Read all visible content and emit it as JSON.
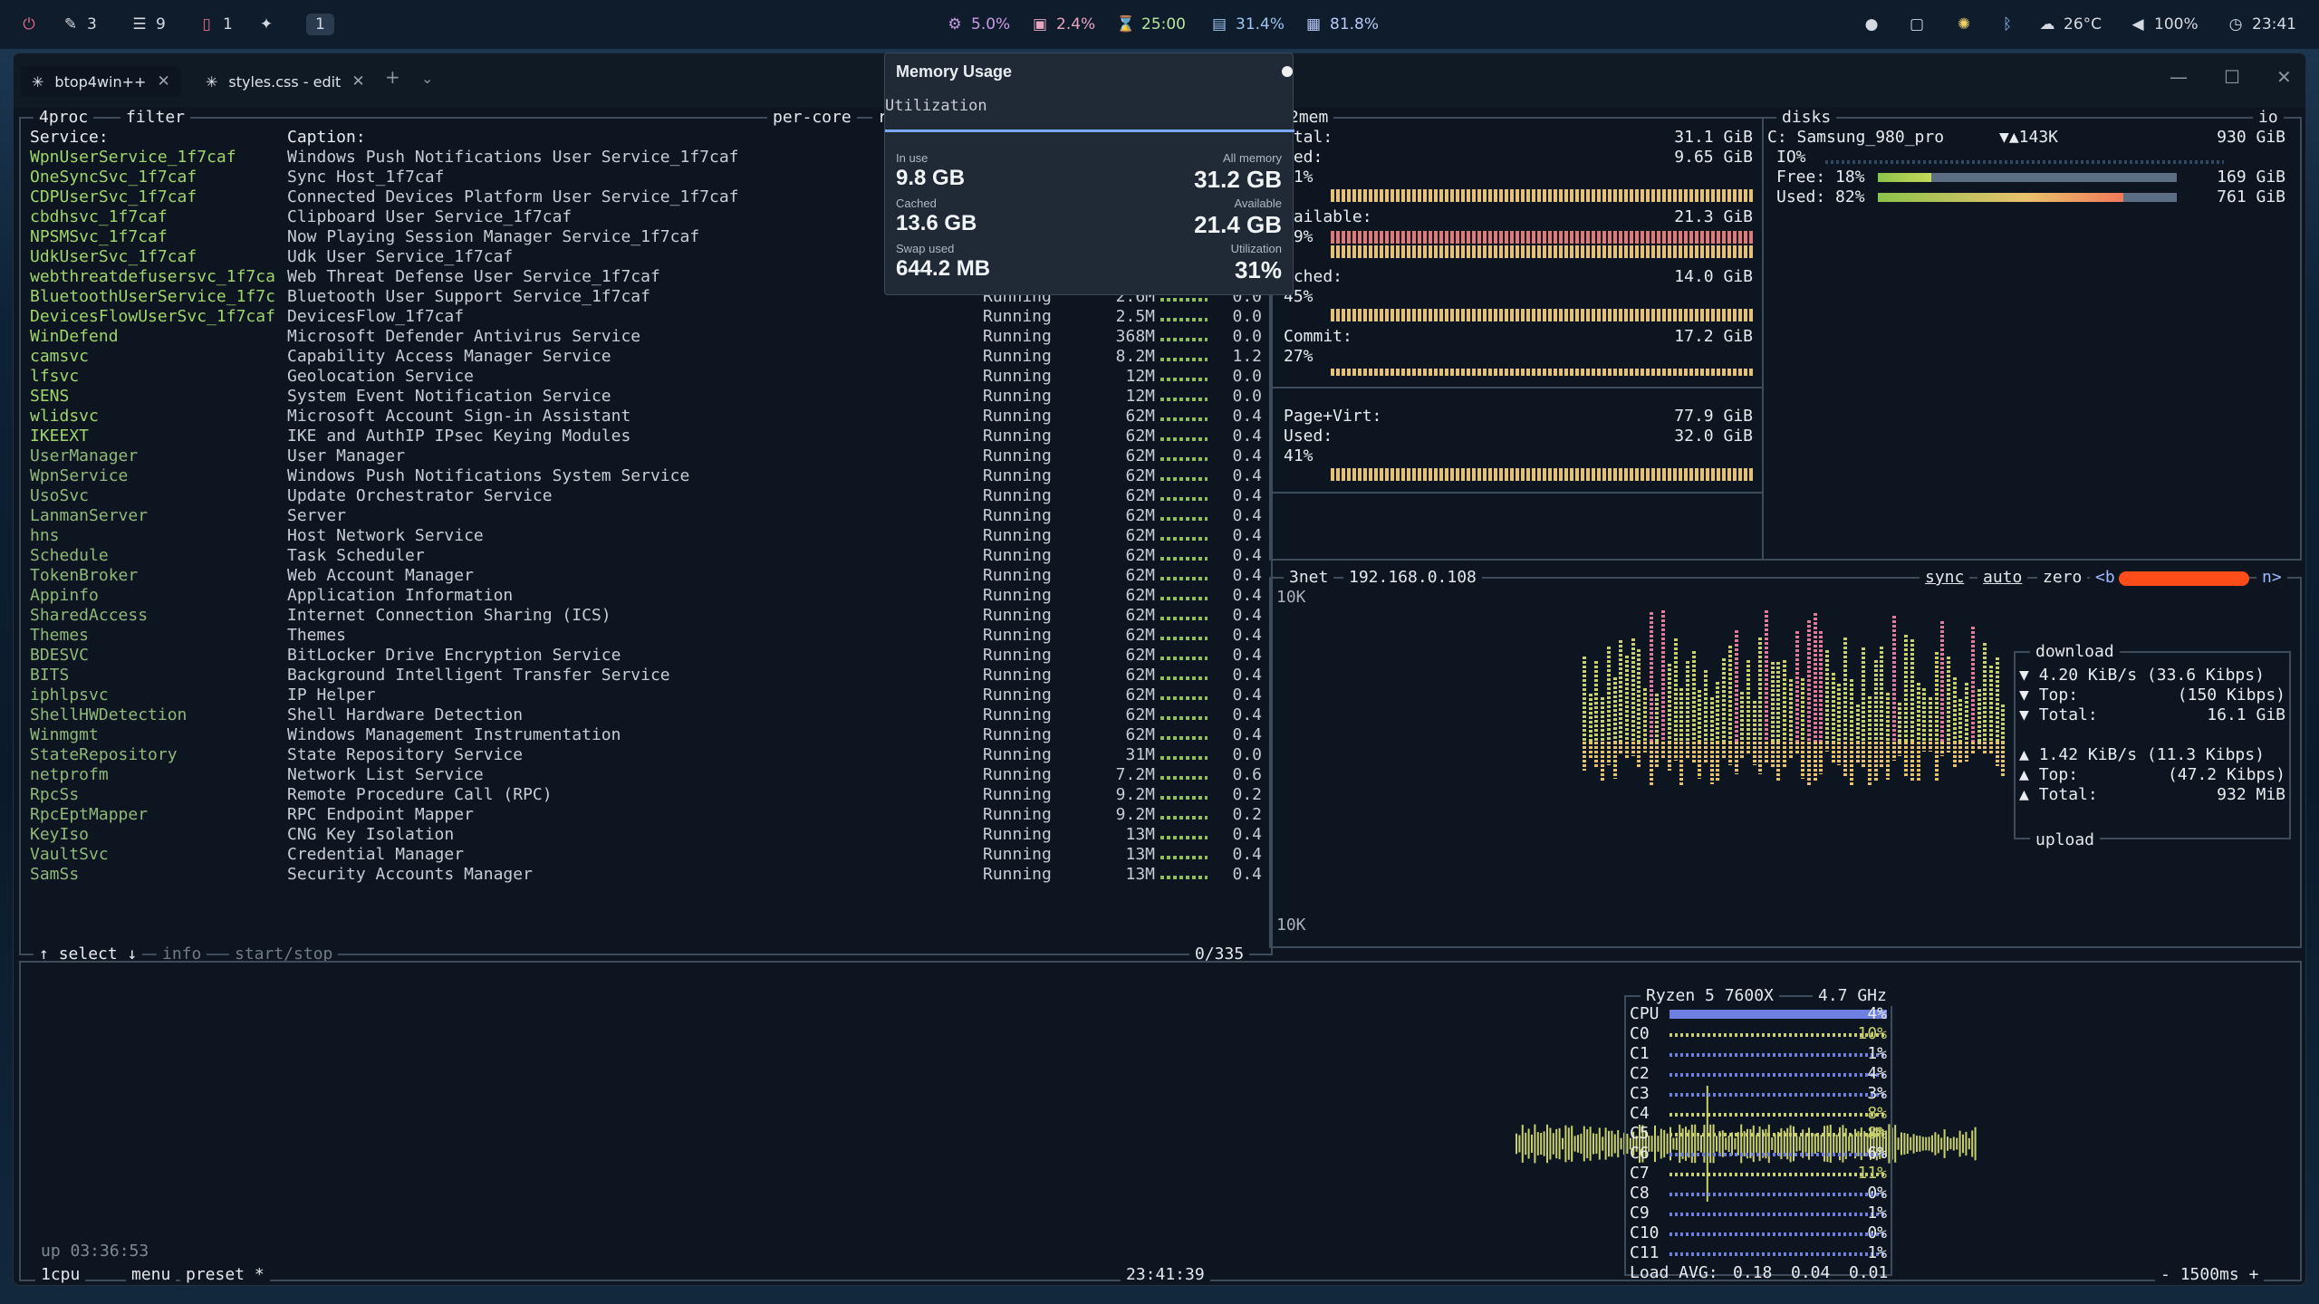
{
  "statusbar": {
    "left": [
      {
        "icon": "power-icon",
        "glyph": "⏻",
        "value": ""
      },
      {
        "icon": "edit-icon",
        "glyph": "✎",
        "value": "3"
      },
      {
        "icon": "list-icon",
        "glyph": "☰",
        "value": "9"
      },
      {
        "icon": "trash-icon",
        "glyph": "🗑",
        "value": "1"
      },
      {
        "icon": "sparkle-icon",
        "glyph": "✦",
        "value": ""
      },
      {
        "icon": "workspace",
        "glyph": "",
        "value": "1"
      }
    ],
    "center": [
      {
        "icon": "cpu-icon",
        "glyph": "⚙",
        "value": "5.0%"
      },
      {
        "icon": "gpu-icon",
        "glyph": "▣",
        "value": "2.4%"
      },
      {
        "icon": "hourglass-icon",
        "glyph": "⌛",
        "value": "25:00"
      },
      {
        "icon": "memory-icon",
        "glyph": "▤",
        "value": "31.4%"
      },
      {
        "icon": "disk-icon",
        "glyph": "▦",
        "value": "81.8%"
      }
    ],
    "right": [
      {
        "icon": "chat-icon",
        "glyph": "●",
        "value": ""
      },
      {
        "icon": "screen-icon",
        "glyph": "▢",
        "value": ""
      },
      {
        "icon": "settings-icon",
        "glyph": "✺",
        "value": ""
      },
      {
        "icon": "bluetooth-icon",
        "glyph": "ᛒ",
        "value": ""
      },
      {
        "icon": "weather-icon",
        "glyph": "☁",
        "value": "26°C"
      },
      {
        "icon": "volume-icon",
        "glyph": "🔊",
        "value": "100%"
      },
      {
        "icon": "clock-icon",
        "glyph": "◷",
        "value": "23:41"
      }
    ]
  },
  "tabs": [
    {
      "label": "btop4win++",
      "active": true
    },
    {
      "label": "styles.css - edit",
      "active": false
    }
  ],
  "popup": {
    "title": "Memory Usage",
    "subtitle": "Utilization",
    "in_use_label": "In use",
    "in_use": "9.8 GB",
    "all_label": "All memory",
    "all": "31.2 GB",
    "cached_label": "Cached",
    "cached": "13.6 GB",
    "avail_label": "Available",
    "avail": "21.4 GB",
    "swap_label": "Swap used",
    "swap": "644.2 MB",
    "util_label": "Utilization",
    "util": "31%"
  },
  "proc": {
    "title_num": "4",
    "title": "proc",
    "filter": "filter",
    "per_core": "per-core",
    "re": "re",
    "hdr_service": "Service:",
    "hdr_caption": "Caption:",
    "footer_select": "select",
    "footer_info": "info",
    "footer_start": "start/stop",
    "count": "0/335",
    "rows": [
      {
        "svc": "WpnUserService_1f7caf",
        "cap": "Windows Push Notifications User Service_1f7caf",
        "stat": "",
        "mem": "",
        "cpu": "",
        "bright": true
      },
      {
        "svc": "OneSyncSvc_1f7caf",
        "cap": "Sync Host_1f7caf",
        "stat": "",
        "mem": "",
        "cpu": "",
        "bright": true
      },
      {
        "svc": "CDPUserSvc_1f7caf",
        "cap": "Connected Devices Platform User Service_1f7caf",
        "stat": "",
        "mem": "",
        "cpu": "",
        "bright": true
      },
      {
        "svc": "cbdhsvc_1f7caf",
        "cap": "Clipboard User Service_1f7caf",
        "stat": "",
        "mem": "",
        "cpu": "",
        "bright": true
      },
      {
        "svc": "NPSMSvc_1f7caf",
        "cap": "Now Playing Session Manager Service_1f7caf",
        "stat": "",
        "mem": "",
        "cpu": "",
        "bright": true
      },
      {
        "svc": "UdkUserSvc_1f7caf",
        "cap": "Udk User Service_1f7caf",
        "stat": "",
        "mem": "",
        "cpu": "",
        "bright": true
      },
      {
        "svc": "webthreatdefusersvc_1f7ca",
        "cap": "Web Threat Defense User Service_1f7caf",
        "stat": "",
        "mem": "",
        "cpu": "",
        "bright": true
      },
      {
        "svc": "BluetoothUserService_1f7c",
        "cap": "Bluetooth User Support Service_1f7caf",
        "stat": "Running",
        "mem": "2.6M",
        "cpu": "0.0",
        "bright": true
      },
      {
        "svc": "DevicesFlowUserSvc_1f7caf",
        "cap": "DevicesFlow_1f7caf",
        "stat": "Running",
        "mem": "2.5M",
        "cpu": "0.0",
        "bright": true
      },
      {
        "svc": "WinDefend",
        "cap": "Microsoft Defender Antivirus Service",
        "stat": "Running",
        "mem": "368M",
        "cpu": "0.0",
        "bright": true
      },
      {
        "svc": "camsvc",
        "cap": "Capability Access Manager Service",
        "stat": "Running",
        "mem": "8.2M",
        "cpu": "1.2",
        "bright": true
      },
      {
        "svc": "lfsvc",
        "cap": "Geolocation Service",
        "stat": "Running",
        "mem": "12M",
        "cpu": "0.0",
        "bright": true
      },
      {
        "svc": "SENS",
        "cap": "System Event Notification Service",
        "stat": "Running",
        "mem": "12M",
        "cpu": "0.0",
        "bright": true
      },
      {
        "svc": "wlidsvc",
        "cap": "Microsoft Account Sign-in Assistant",
        "stat": "Running",
        "mem": "62M",
        "cpu": "0.4",
        "bright": true
      },
      {
        "svc": "IKEEXT",
        "cap": "IKE and AuthIP IPsec Keying Modules",
        "stat": "Running",
        "mem": "62M",
        "cpu": "0.4",
        "bright": true
      },
      {
        "svc": "UserManager",
        "cap": "User Manager",
        "stat": "Running",
        "mem": "62M",
        "cpu": "0.4",
        "bright": false
      },
      {
        "svc": "WpnService",
        "cap": "Windows Push Notifications System Service",
        "stat": "Running",
        "mem": "62M",
        "cpu": "0.4",
        "bright": false
      },
      {
        "svc": "UsoSvc",
        "cap": "Update Orchestrator Service",
        "stat": "Running",
        "mem": "62M",
        "cpu": "0.4",
        "bright": false
      },
      {
        "svc": "LanmanServer",
        "cap": "Server",
        "stat": "Running",
        "mem": "62M",
        "cpu": "0.4",
        "bright": false
      },
      {
        "svc": "hns",
        "cap": "Host Network Service",
        "stat": "Running",
        "mem": "62M",
        "cpu": "0.4",
        "bright": false
      },
      {
        "svc": "Schedule",
        "cap": "Task Scheduler",
        "stat": "Running",
        "mem": "62M",
        "cpu": "0.4",
        "bright": false
      },
      {
        "svc": "TokenBroker",
        "cap": "Web Account Manager",
        "stat": "Running",
        "mem": "62M",
        "cpu": "0.4",
        "bright": false
      },
      {
        "svc": "Appinfo",
        "cap": "Application Information",
        "stat": "Running",
        "mem": "62M",
        "cpu": "0.4",
        "bright": false
      },
      {
        "svc": "SharedAccess",
        "cap": "Internet Connection Sharing (ICS)",
        "stat": "Running",
        "mem": "62M",
        "cpu": "0.4",
        "bright": false
      },
      {
        "svc": "Themes",
        "cap": "Themes",
        "stat": "Running",
        "mem": "62M",
        "cpu": "0.4",
        "bright": false
      },
      {
        "svc": "BDESVC",
        "cap": "BitLocker Drive Encryption Service",
        "stat": "Running",
        "mem": "62M",
        "cpu": "0.4",
        "bright": false
      },
      {
        "svc": "BITS",
        "cap": "Background Intelligent Transfer Service",
        "stat": "Running",
        "mem": "62M",
        "cpu": "0.4",
        "bright": false
      },
      {
        "svc": "iphlpsvc",
        "cap": "IP Helper",
        "stat": "Running",
        "mem": "62M",
        "cpu": "0.4",
        "bright": false
      },
      {
        "svc": "ShellHWDetection",
        "cap": "Shell Hardware Detection",
        "stat": "Running",
        "mem": "62M",
        "cpu": "0.4",
        "bright": false
      },
      {
        "svc": "Winmgmt",
        "cap": "Windows Management Instrumentation",
        "stat": "Running",
        "mem": "62M",
        "cpu": "0.4",
        "bright": false
      },
      {
        "svc": "StateRepository",
        "cap": "State Repository Service",
        "stat": "Running",
        "mem": "31M",
        "cpu": "0.0",
        "bright": false
      },
      {
        "svc": "netprofm",
        "cap": "Network List Service",
        "stat": "Running",
        "mem": "7.2M",
        "cpu": "0.6",
        "bright": false
      },
      {
        "svc": "RpcSs",
        "cap": "Remote Procedure Call (RPC)",
        "stat": "Running",
        "mem": "9.2M",
        "cpu": "0.2",
        "bright": false
      },
      {
        "svc": "RpcEptMapper",
        "cap": "RPC Endpoint Mapper",
        "stat": "Running",
        "mem": "9.2M",
        "cpu": "0.2",
        "bright": false
      },
      {
        "svc": "KeyIso",
        "cap": "CNG Key Isolation",
        "stat": "Running",
        "mem": "13M",
        "cpu": "0.4",
        "bright": false
      },
      {
        "svc": "VaultSvc",
        "cap": "Credential Manager",
        "stat": "Running",
        "mem": "13M",
        "cpu": "0.4",
        "bright": false
      },
      {
        "svc": "SamSs",
        "cap": "Security Accounts Manager",
        "stat": "Running",
        "mem": "13M",
        "cpu": "0.4",
        "bright": false
      }
    ]
  },
  "mem": {
    "title_num": "2",
    "title": "mem",
    "total_label": "otal:",
    "total": "31.1 GiB",
    "used_label": "sed:",
    "used": "9.65 GiB",
    "used_pct": "31%",
    "avail_label": "vailable:",
    "avail": "21.3 GiB",
    "avail_pct": "69%",
    "cached_label": "ached:",
    "cached": "14.0 GiB",
    "cached_pct": "45%",
    "commit_label": "Commit:",
    "commit": "17.2 GiB",
    "commit_pct": "27%",
    "pagevirt_label": "Page+Virt:",
    "pagevirt": "77.9 GiB",
    "pv_used_label": "Used:",
    "pv_used": "32.0 GiB",
    "pv_used_pct": "41%",
    "colors": {
      "used": "#e8c26b",
      "avail": "#e07a7a",
      "cached": "#e8c26b",
      "commit": "#e8c26b",
      "pv": "#e8c26b"
    }
  },
  "disks": {
    "title": "disks",
    "io": "io",
    "drive": "C: Samsung_980_pro",
    "rate": "▼▲143K",
    "size": "930 GiB",
    "io_label": "IO%",
    "free_label": "Free: 18%",
    "free": "169 GiB",
    "free_frac": 0.18,
    "used_label": "Used: 82%",
    "used": "761 GiB",
    "used_frac": 0.82
  },
  "net": {
    "title_num": "3",
    "title": "net",
    "ip": "192.168.0.108",
    "sync": "sync",
    "auto": "auto",
    "zero": "zero",
    "b": "<b",
    "n": "n>",
    "scale_top": "10K",
    "scale_bot": "10K",
    "download_label": "download",
    "upload_label": "upload",
    "dl_rate": "4.20 KiB/s (33.6 Kibps)",
    "dl_top_label": "Top:",
    "dl_top": "(150 Kibps)",
    "dl_total_label": "Total:",
    "dl_total": "16.1 GiB",
    "ul_rate": "1.42 KiB/s (11.3 Kibps)",
    "ul_top_label": "Top:",
    "ul_top": "(47.2 Kibps)",
    "ul_total_label": "Total:",
    "ul_total": "932 MiB"
  },
  "cpu": {
    "title_num": "1",
    "title": "cpu",
    "menu": "menu",
    "preset": "preset *",
    "uptime": "up 03:36:53",
    "clock": "23:41:39",
    "interval": "1500ms",
    "minus": "-",
    "plus": "+",
    "model": "Ryzen 5 7600X",
    "freq": "4.7 GHz",
    "cores": [
      {
        "name": "CPU",
        "pct": "4%",
        "frac": 0.04
      },
      {
        "name": "C0",
        "pct": "10%",
        "frac": 0.1
      },
      {
        "name": "C1",
        "pct": "1%",
        "frac": 0.01
      },
      {
        "name": "C2",
        "pct": "4%",
        "frac": 0.04
      },
      {
        "name": "C3",
        "pct": "3%",
        "frac": 0.03
      },
      {
        "name": "C4",
        "pct": "8%",
        "frac": 0.08
      },
      {
        "name": "C5",
        "pct": "8%",
        "frac": 0.08
      },
      {
        "name": "C6",
        "pct": "6%",
        "frac": 0.06
      },
      {
        "name": "C7",
        "pct": "11%",
        "frac": 0.11
      },
      {
        "name": "C8",
        "pct": "0%",
        "frac": 0.0
      },
      {
        "name": "C9",
        "pct": "1%",
        "frac": 0.01
      },
      {
        "name": "C10",
        "pct": "0%",
        "frac": 0.0
      },
      {
        "name": "C11",
        "pct": "1%",
        "frac": 0.01
      }
    ],
    "load_label": "Load AVG:",
    "load1": "0.18",
    "load5": "0.04",
    "load15": "0.01"
  }
}
